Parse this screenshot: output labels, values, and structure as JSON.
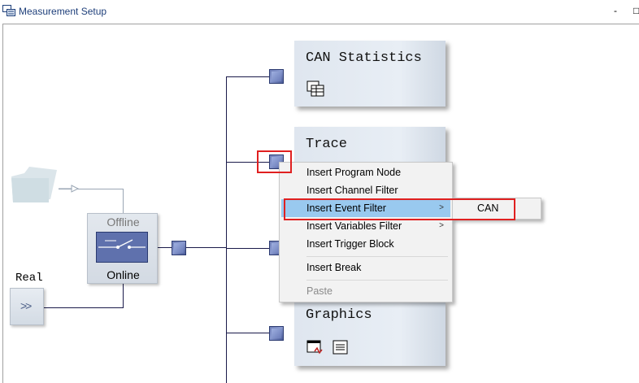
{
  "window": {
    "title": "Measurement Setup",
    "controls": [
      "-",
      "□"
    ]
  },
  "blocks": {
    "can_statistics": "CAN Statistics",
    "trace": "Trace",
    "graphics": "Graphics"
  },
  "offline_switch": {
    "offline_label": "Offline",
    "online_label": "Online"
  },
  "real": {
    "label": "Real",
    "button_glyph": ">>"
  },
  "context_menu": {
    "items": [
      {
        "label": "Insert Program Node"
      },
      {
        "label": "Insert Channel Filter"
      },
      {
        "label": "Insert Event Filter"
      },
      {
        "label": "Insert Variables Filter"
      },
      {
        "label": "Insert Trigger Block"
      },
      {
        "label": "Insert Break"
      },
      {
        "label": "Paste"
      }
    ],
    "highlighted": "Insert Event Filter",
    "submenu_arrow": ">"
  },
  "submenu": {
    "items": [
      {
        "label": "CAN"
      }
    ]
  },
  "colors": {
    "highlight": "#99c9ef",
    "annotation": "#e02020",
    "node": "#6f7fb8"
  }
}
